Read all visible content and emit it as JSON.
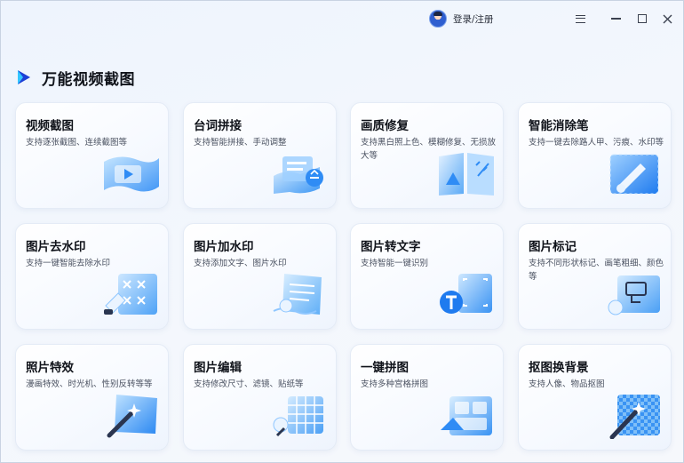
{
  "titlebar": {
    "user_label": "登录/注册"
  },
  "app": {
    "title": "万能视频截图"
  },
  "colors": {
    "accent": "#2f8cf5",
    "accent_light": "#9fd0ff",
    "title_text": "#10131a"
  },
  "cards": [
    {
      "title": "视频截图",
      "desc": "支持逐张截图、连续截图等",
      "icon": "film-strip-icon"
    },
    {
      "title": "台词拼接",
      "desc": "支持智能拼接、手动调整",
      "icon": "document-stack-icon"
    },
    {
      "title": "画质修复",
      "desc": "支持黑白照上色、模糊修复、无损放大等",
      "icon": "photo-enhance-icon"
    },
    {
      "title": "智能消除笔",
      "desc": "支持一键去除路人甲、污痕、水印等",
      "icon": "eraser-pen-icon"
    },
    {
      "title": "图片去水印",
      "desc": "支持一键智能去除水印",
      "icon": "watermark-remove-icon"
    },
    {
      "title": "图片加水印",
      "desc": "支持添加文字、图片水印",
      "icon": "watermark-add-icon"
    },
    {
      "title": "图片转文字",
      "desc": "支持智能一键识别",
      "icon": "ocr-text-icon"
    },
    {
      "title": "图片标记",
      "desc": "支持不同形状标记、画笔粗细、颜色等",
      "icon": "image-markup-icon"
    },
    {
      "title": "照片特效",
      "desc": "漫画特效、时光机、性别反转等等",
      "icon": "magic-wand-icon"
    },
    {
      "title": "图片编辑",
      "desc": "支持修改尺寸、滤镜、贴纸等",
      "icon": "grid-edit-icon"
    },
    {
      "title": "一键拼图",
      "desc": "支持多种宫格拼图",
      "icon": "collage-icon"
    },
    {
      "title": "抠图换背景",
      "desc": "支持人像、物品抠图",
      "icon": "cutout-background-icon"
    }
  ]
}
